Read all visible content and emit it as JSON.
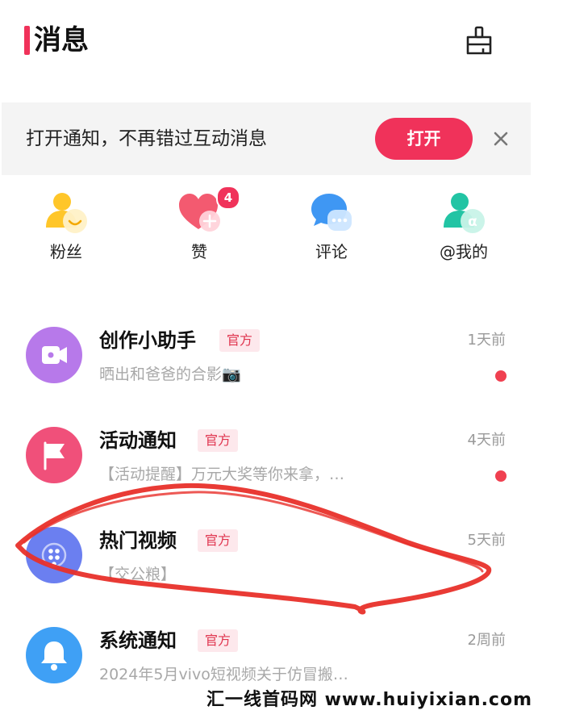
{
  "header": {
    "title": "消息",
    "clean_icon": "broom-icon"
  },
  "banner": {
    "text": "打开通知，不再错过互动消息",
    "open_label": "打开",
    "close_icon": "close-icon"
  },
  "quick_actions": [
    {
      "label": "粉丝",
      "icon": "fans-icon"
    },
    {
      "label": "赞",
      "icon": "heart-icon",
      "badge": "4"
    },
    {
      "label": "评论",
      "icon": "comment-icon"
    },
    {
      "label": "@我的",
      "icon": "mention-icon"
    }
  ],
  "messages": [
    {
      "name": "创作小助手",
      "tag": "官方",
      "time": "1天前",
      "preview": "晒出和爸爸的合影📷",
      "unread": true,
      "icon": "video-camera-icon",
      "color": "#b779ea"
    },
    {
      "name": "活动通知",
      "tag": "官方",
      "time": "4天前",
      "preview": "【活动提醒】万元大奖等你来拿，…",
      "unread": true,
      "icon": "flag-icon",
      "color": "#f0507a"
    },
    {
      "name": "热门视频",
      "tag": "官方",
      "time": "5天前",
      "preview": "【交公粮】",
      "unread": false,
      "icon": "dots-icon",
      "color": "#6b7ff0"
    },
    {
      "name": "系统通知",
      "tag": "官方",
      "time": "2周前",
      "preview": "2024年5月vivo短视频关于仿冒搬…",
      "unread": false,
      "icon": "bell-icon",
      "color": "#3fa0f5"
    }
  ],
  "watermark": "汇一线首码网 www.huiyixian.com",
  "colors": {
    "accent": "#f0325a",
    "annotation": "#e8302a"
  }
}
